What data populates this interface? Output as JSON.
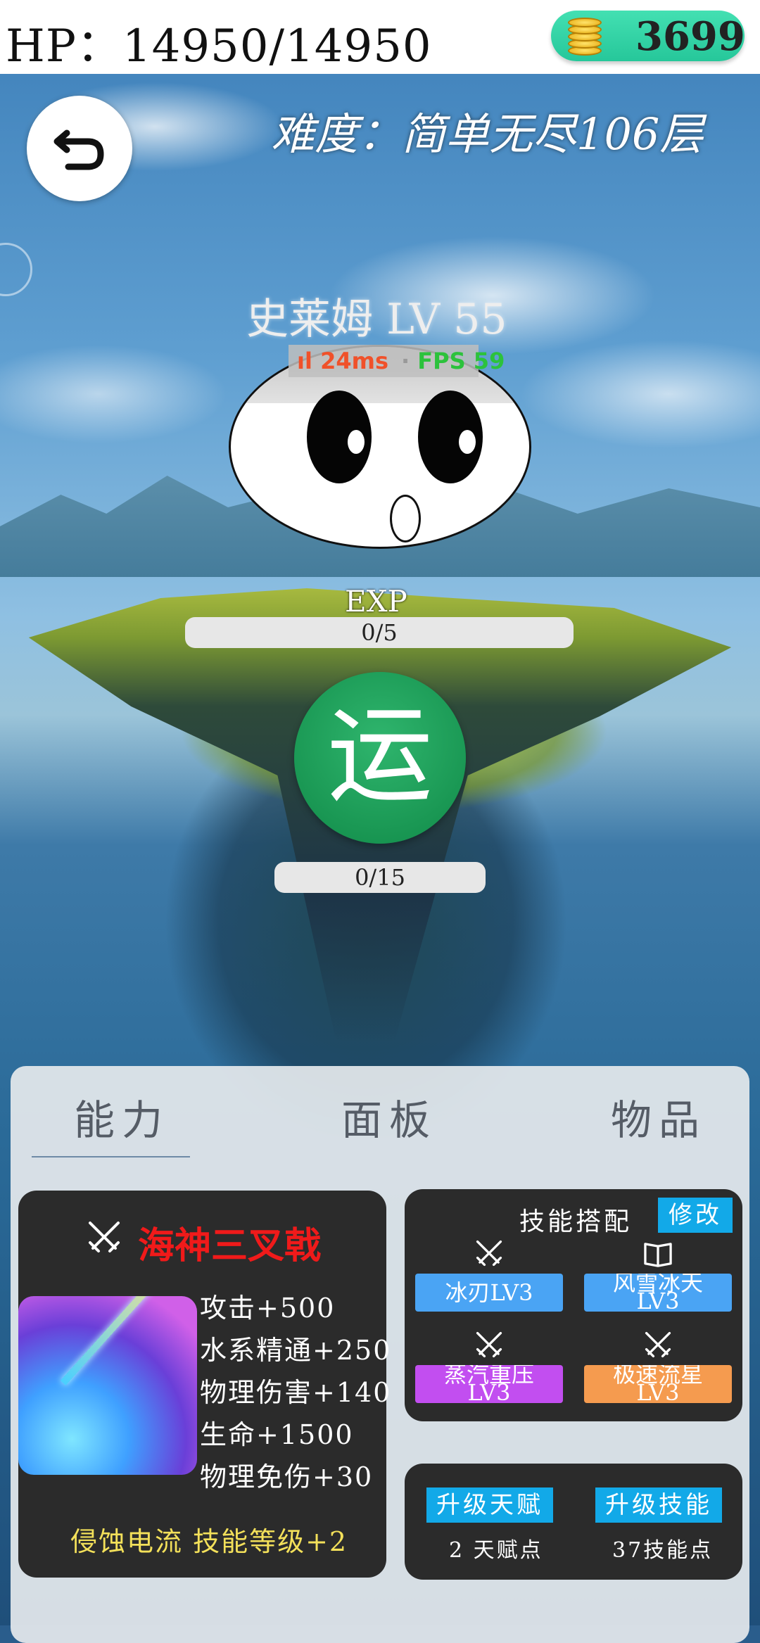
{
  "header": {
    "hp_label": "HP：",
    "hp_value": "14950/14950",
    "coins": "3699"
  },
  "difficulty": "难度：简单无尽106层",
  "monster": {
    "name_level": "史莱姆 LV 55"
  },
  "overlay": {
    "ping": "24ms",
    "fps": "FPS 59"
  },
  "exp": {
    "label": "EXP",
    "value": "0/5",
    "fraction": 0
  },
  "luck": {
    "glyph": "运",
    "value": "0/15",
    "fraction": 0
  },
  "tabs": [
    {
      "label": "能力",
      "active": true
    },
    {
      "label": "面板",
      "active": false
    },
    {
      "label": "物品",
      "active": false
    }
  ],
  "weapon": {
    "name": "海神三叉戟",
    "icon": "crossed-swords-icon",
    "stats": [
      "攻击+500",
      "水系精通+250",
      "物理伤害+140",
      "生命+1500",
      "物理免伤+30"
    ],
    "bonus": "侵蚀电流 技能等级+2"
  },
  "skills": {
    "title": "技能搭配",
    "edit_label": "修改",
    "slots": [
      {
        "line1": "冰刃LV3",
        "line2": "",
        "color": "#4aa4f4",
        "icon": "crossed-swords-icon"
      },
      {
        "line1": "风雪冰天",
        "line2": "LV3",
        "color": "#4aa4f4",
        "icon": "book-icon"
      },
      {
        "line1": "蒸汽重压",
        "line2": "LV3",
        "color": "#c24ef0",
        "icon": "crossed-swords-icon"
      },
      {
        "line1": "极速流星",
        "line2": "LV3",
        "color": "#f59b4f",
        "icon": "crossed-swords-icon"
      }
    ]
  },
  "upgrade": {
    "talent_label": "升级天赋",
    "talent_points": "2 天赋点",
    "skill_label": "升级技能",
    "skill_points": "37技能点"
  },
  "colors": {
    "coin_pill": "#2fd3a6",
    "luck_circle": "#16994f",
    "weapon_name": "#f01a1a",
    "bonus_text": "#f3e05a",
    "button_blue": "#12a9e8",
    "card_bg": "#2b2b2b"
  }
}
